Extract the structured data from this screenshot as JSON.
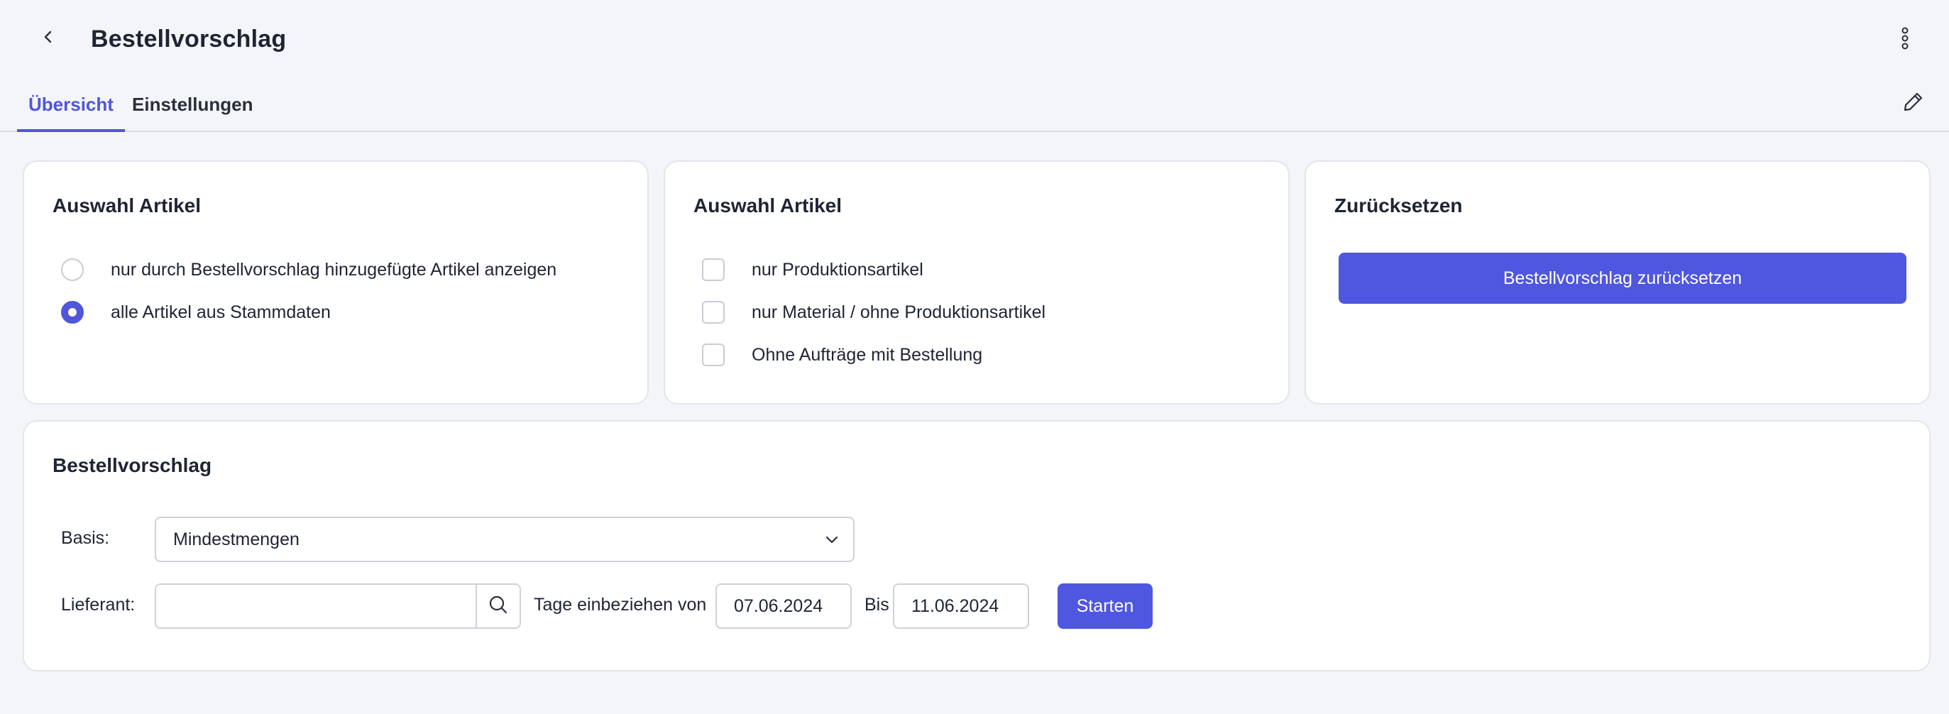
{
  "header": {
    "title": "Bestellvorschlag"
  },
  "tabs": [
    {
      "label": "Übersicht",
      "active": true
    },
    {
      "label": "Einstellungen",
      "active": false
    }
  ],
  "cards": {
    "selection_scope": {
      "title": "Auswahl Artikel",
      "options": [
        {
          "label": "nur durch Bestellvorschlag hinzugefügte Artikel anzeigen",
          "checked": false
        },
        {
          "label": "alle Artikel aus Stammdaten",
          "checked": true
        }
      ]
    },
    "selection_filters": {
      "title": "Auswahl Artikel",
      "options": [
        {
          "label": "nur Produktionsartikel",
          "checked": false
        },
        {
          "label": "nur Material / ohne Produktionsartikel",
          "checked": false
        },
        {
          "label": "Ohne Aufträge mit Bestellung",
          "checked": false
        }
      ]
    },
    "reset": {
      "title": "Zurücksetzen",
      "button_label": "Bestellvorschlag zurücksetzen"
    },
    "proposal": {
      "title": "Bestellvorschlag",
      "basis_label": "Basis:",
      "basis_value": "Mindestmengen",
      "supplier_label": "Lieferant:",
      "supplier_value": "",
      "days_from_label": "Tage einbeziehen von",
      "date_from": "07.06.2024",
      "to_label": "Bis",
      "date_to": "11.06.2024",
      "start_label": "Starten"
    }
  },
  "colors": {
    "accent": "#4f56d8",
    "button": "#4f56e0",
    "background": "#f4f5f9",
    "card": "#ffffff",
    "border": "#e2e5ec"
  },
  "icons": {
    "back": "chevron-left-icon",
    "more": "more-vertical-icon",
    "edit": "pencil-icon",
    "select": "chevron-down-icon",
    "search": "search-icon"
  }
}
